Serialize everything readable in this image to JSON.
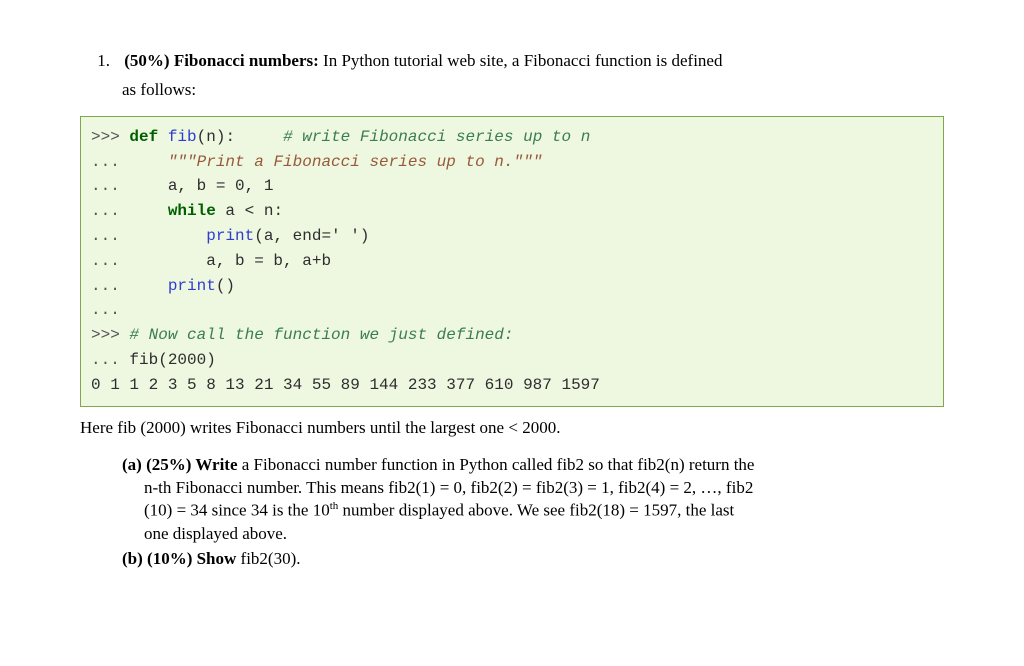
{
  "q": {
    "num": "1.",
    "header_bold": "(50%) Fibonacci numbers:",
    "header_rest": " In Python tutorial web site, a Fibonacci function is defined",
    "header_line2": "as follows:"
  },
  "code": {
    "p1": ">>> ",
    "p2": "... ",
    "kw_def": "def",
    "fn_fib": "fib",
    "defrest": "(n):     ",
    "c1": "# write Fibonacci series up to n",
    "indent1": "    ",
    "docq": "\"\"\"",
    "docstr": "Print a Fibonacci series up to n.",
    "l3": "    a, b = 0, 1",
    "kw_while": "while",
    "while_rest": " a < n:",
    "l5a": "        ",
    "fn_print": "print",
    "l5b": "(a, end=' ')",
    "l6": "        a, b = b, a+b",
    "l7b": "()",
    "blank": "",
    "c2": "# Now call the function we just defined:",
    "call": "fib(2000)",
    "out": "0 1 1 2 3 5 8 13 21 34 55 89 144 233 377 610 987 1597"
  },
  "post": "Here fib (2000) writes Fibonacci numbers until the largest one < 2000.",
  "a": {
    "label": "(a) (25%) Write",
    "rest1": " a Fibonacci number function in Python called fib2 so that fib2(n) return the",
    "line2": "n-th Fibonacci number. This means fib2(1) = 0, fib2(2) = fib2(3) = 1, fib2(4) = 2, …, fib2",
    "line3a": "(10) = 34 since 34 is the 10",
    "line3sup": "th",
    "line3b": " number displayed above. We see fib2(18) = 1597, the last",
    "line4": "one displayed above."
  },
  "b": {
    "label": "(b) (10%) Show",
    "rest": " fib2(30)."
  }
}
